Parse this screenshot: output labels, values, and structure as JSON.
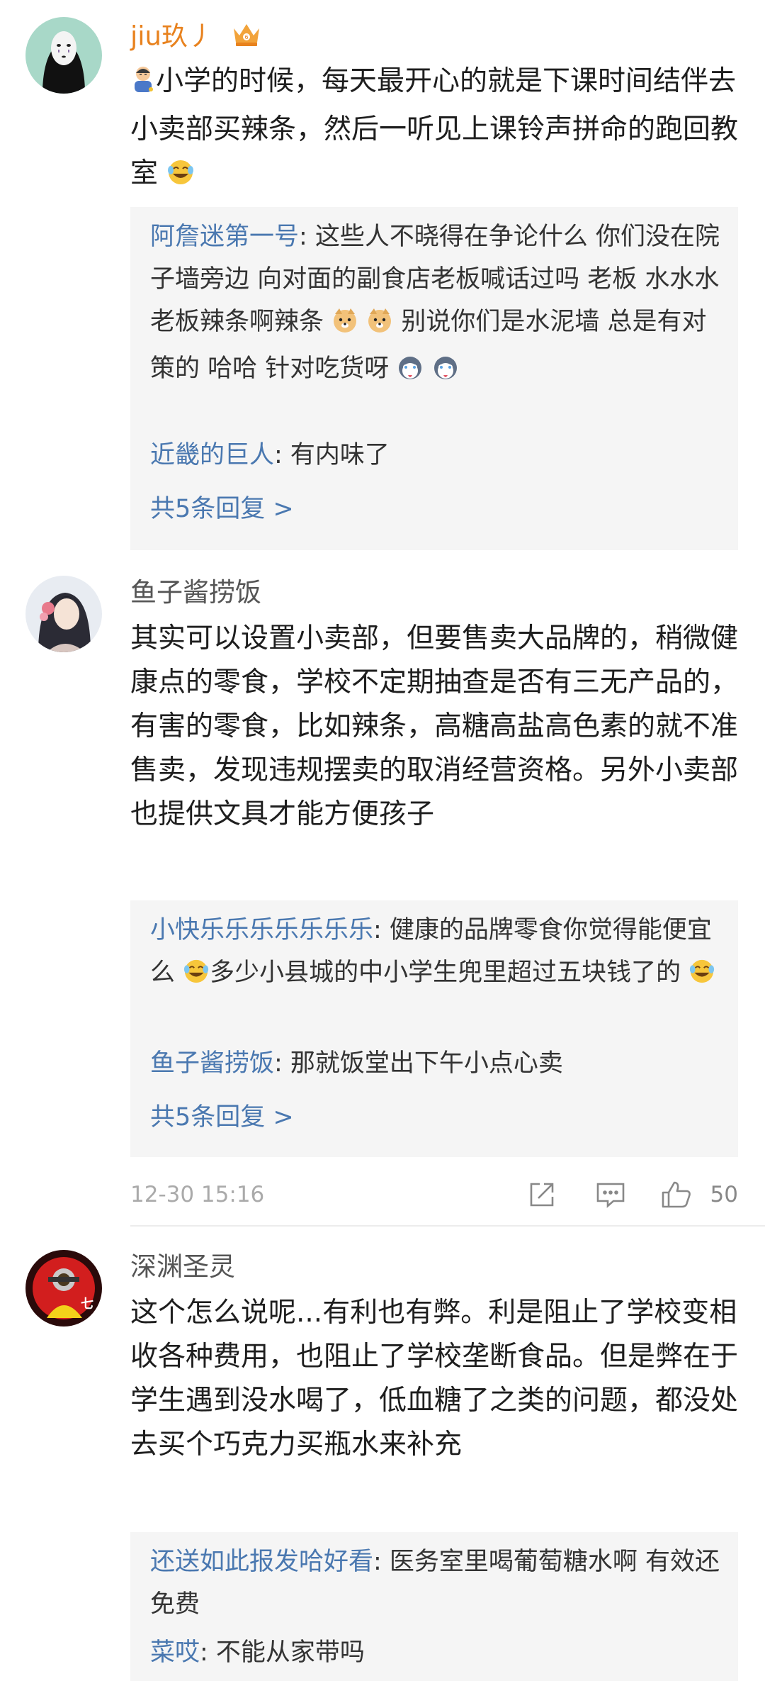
{
  "comments": [
    {
      "username": "jiu玖丿",
      "text_a": "小学的时候，每天最开心的就是下课时间结伴去小卖部买辣条，然后一听见上课铃声拼命的跑回教室",
      "replies": [
        {
          "name": "阿詹迷第一号",
          "text_a": ": 这些人不晓得在争论什么 你们没在院子墙旁边 向对面的副食店老板喊话过吗 老板 水水水 老板辣条啊辣条",
          "text_b": " 别说你们是水泥墙 总是有对策的 哈哈 针对吃货呀"
        },
        {
          "name": "近畿的巨人",
          "text_a": ": 有内味了"
        }
      ],
      "more": "共5条回复 >"
    },
    {
      "username": "鱼子酱捞饭",
      "text_a": "其实可以设置小卖部，但要售卖大品牌的，稍微健康点的零食，学校不定期抽查是否有三无产品的，有害的零食，比如辣条，高糖高盐高色素的就不准售卖，发现违规摆卖的取消经营资格。另外小卖部也提供文具才能方便孩子",
      "replies": [
        {
          "name": "小快乐乐乐乐乐乐乐",
          "text_a": ": 健康的品牌零食你觉得能便宜么",
          "text_b": "多少小县城的中小学生兜里超过五块钱了的"
        },
        {
          "name": "鱼子酱捞饭",
          "text_a": ": 那就饭堂出下午小点心卖"
        }
      ],
      "more": "共5条回复 >",
      "time": "12-30 15:16",
      "likes": "50"
    },
    {
      "username": "深渊圣灵",
      "text_a": "这个怎么说呢...有利也有弊。利是阻止了学校变相收各种费用，也阻止了学校垄断食品。但是弊在于学生遇到没水喝了，低血糖了之类的问题，都没处去买个巧克力买瓶水来补充",
      "replies": [
        {
          "name": "还送如此报发哈好看",
          "text_a": ": 医务室里喝葡萄糖水啊 有效还免费"
        },
        {
          "name": "菜哎",
          "text_a": ": 不能从家带吗"
        }
      ]
    }
  ],
  "icons": {
    "vip": "crown-badge-icon",
    "share": "share-icon",
    "comment": "comment-icon",
    "like": "thumbs-up-icon"
  },
  "colors": {
    "username_vip": "#e8821e",
    "reply_name": "#4a78b0",
    "reply_bg": "#f5f5f5"
  }
}
